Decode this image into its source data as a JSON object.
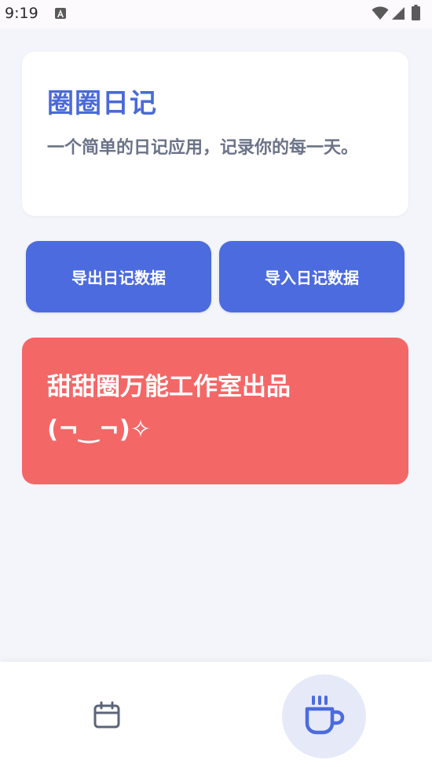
{
  "status_bar": {
    "time": "9:19",
    "icons": [
      "text-input-icon",
      "wifi-icon",
      "signal-icon",
      "battery-icon"
    ]
  },
  "info_card": {
    "title": "圈圈日记",
    "description": "一个简单的日记应用，记录你的每一天。"
  },
  "actions": {
    "export_label": "导出日记数据",
    "import_label": "导入日记数据"
  },
  "credit": {
    "text": "甜甜圈万能工作室出品 (¬‿¬)✧"
  },
  "bottom_nav": {
    "items": [
      {
        "icon": "calendar-icon",
        "active": false
      },
      {
        "icon": "coffee-cup-icon",
        "active": true
      }
    ]
  },
  "colors": {
    "accent": "#4b6bde",
    "title": "#4a6ad8",
    "credit_background": "#f46767",
    "page_background": "#f4f5fa",
    "nav_active_background": "#e6e9f8"
  }
}
